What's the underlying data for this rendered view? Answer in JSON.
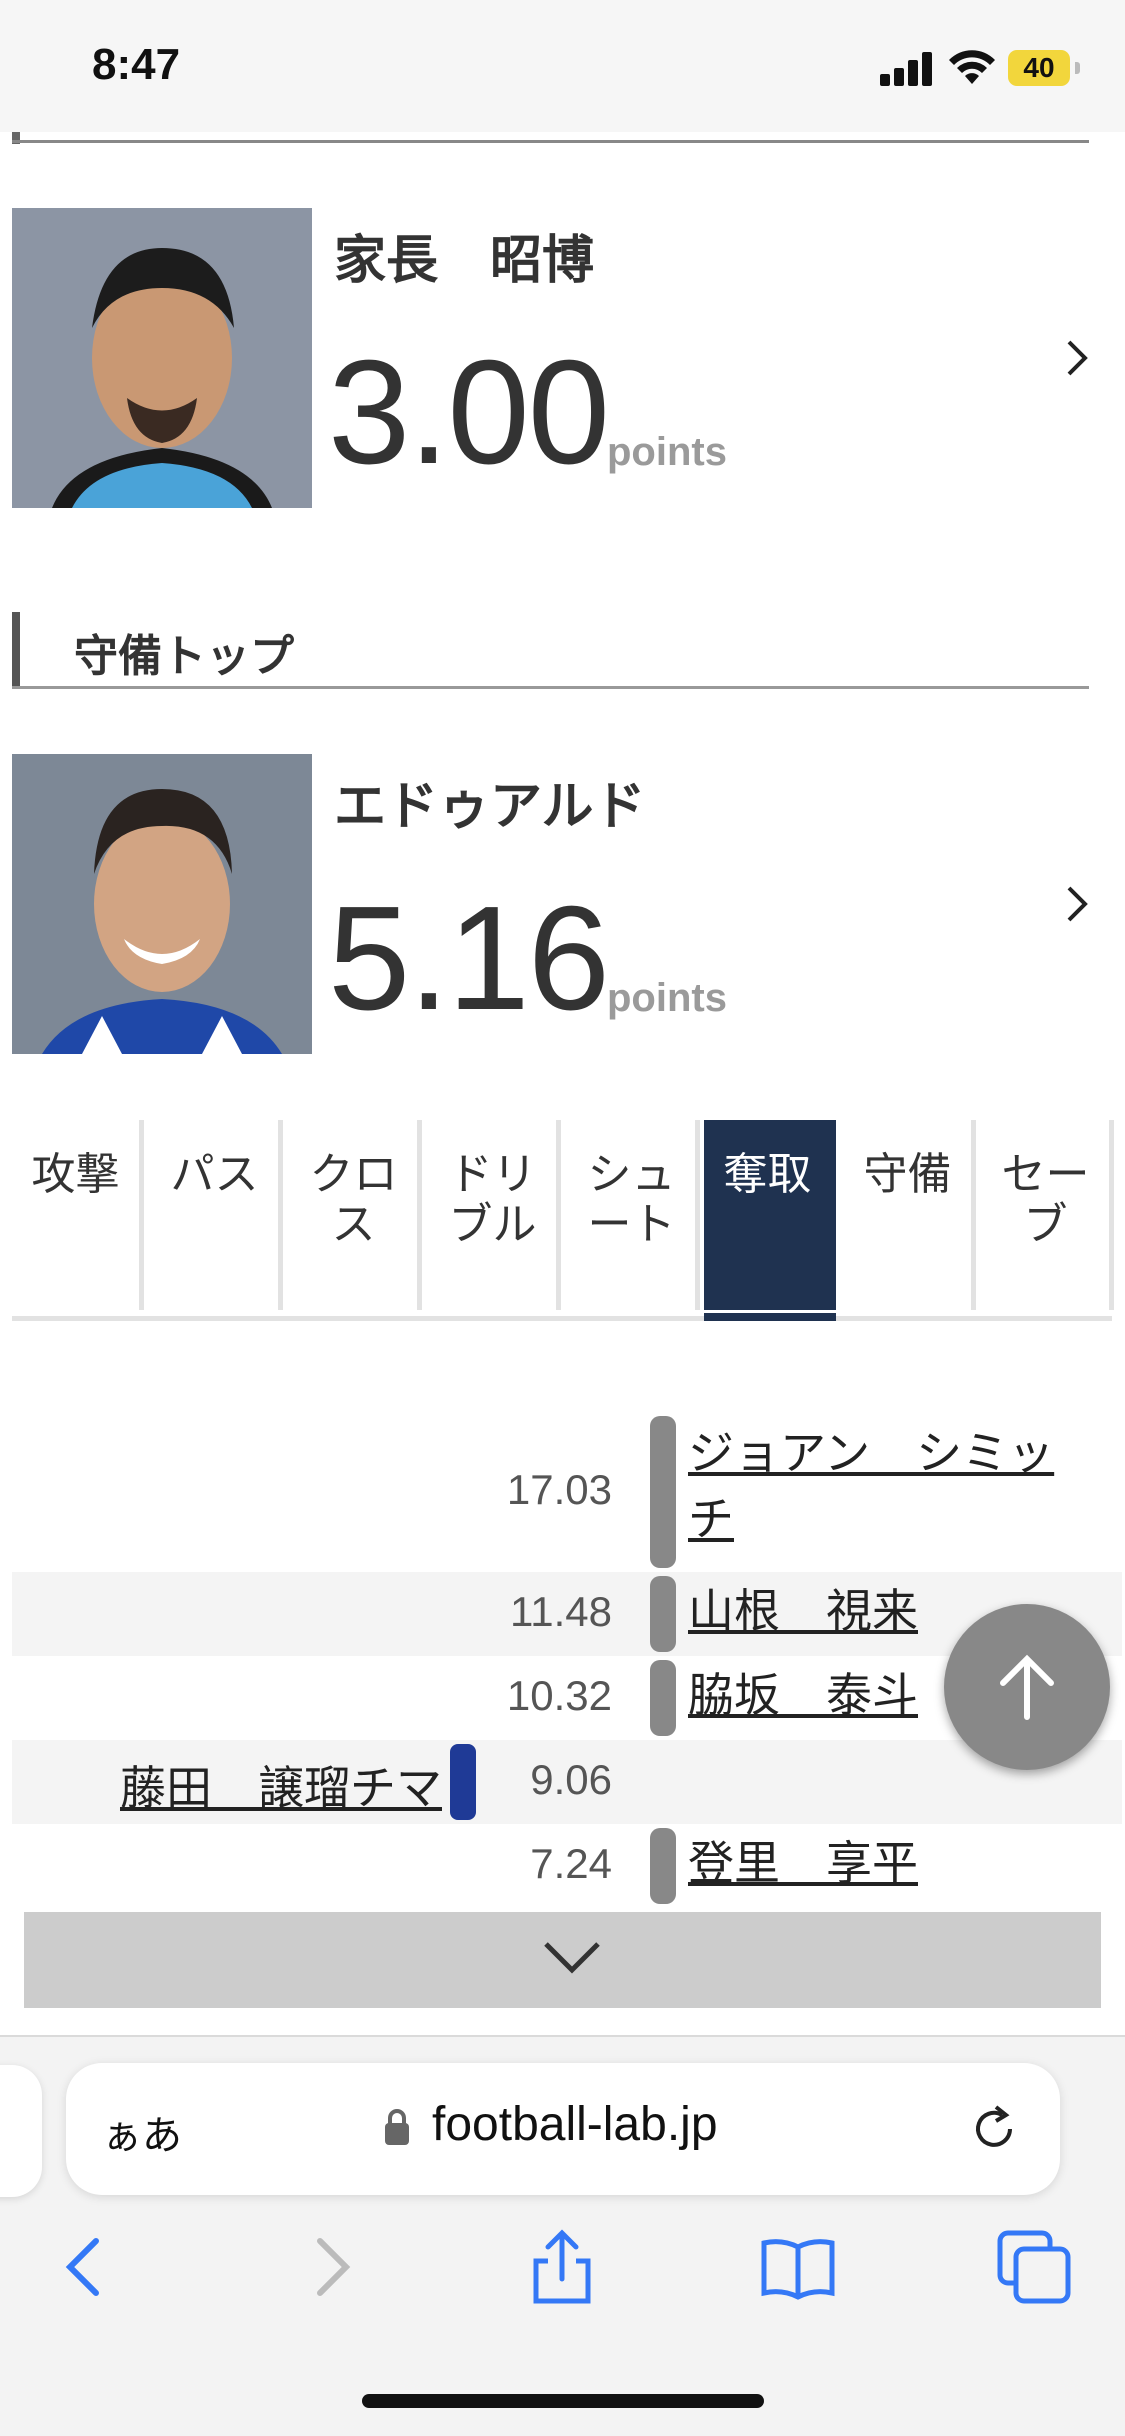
{
  "status_bar": {
    "time": "8:47",
    "battery": "40"
  },
  "players": [
    {
      "name": "家長　昭博",
      "points": "3.00",
      "points_label": "points"
    },
    {
      "name": "エドゥアルド",
      "points": "5.16",
      "points_label": "points"
    }
  ],
  "section": {
    "title": "守備トップ"
  },
  "tabs": [
    {
      "label": "攻撃",
      "active": false
    },
    {
      "label": "パス",
      "active": false
    },
    {
      "label": "クロ\nス",
      "active": false
    },
    {
      "label": "ドリ\nブル",
      "active": false
    },
    {
      "label": "シュ\nート",
      "active": false
    },
    {
      "label": "奪取",
      "active": true
    },
    {
      "label": "守備",
      "active": false
    },
    {
      "label": "セー\nブ",
      "active": false
    }
  ],
  "ranking": [
    {
      "value": "17.03",
      "name": "ジョアン　シミッ\nチ",
      "side": "right"
    },
    {
      "value": "11.48",
      "name": "山根　視来",
      "side": "right"
    },
    {
      "value": "10.32",
      "name": "脇坂　泰斗",
      "side": "right"
    },
    {
      "value": "9.06",
      "name": "藤田　譲瑠チマ",
      "side": "left"
    },
    {
      "value": "7.24",
      "name": "登里　享平",
      "side": "right"
    }
  ],
  "browser": {
    "aa_label": "ぁあ",
    "url": "football-lab.jp"
  },
  "colors": {
    "active_tab": "#1f3250",
    "home_bar": "#888888",
    "away_bar": "#1f3a96",
    "link_blue": "#3478f6"
  },
  "icons": [
    "signal-icon",
    "wifi-icon",
    "battery-icon",
    "chevron-right-icon",
    "chevron-down-icon",
    "arrow-up-icon",
    "lock-icon",
    "reload-icon",
    "back-icon",
    "forward-icon",
    "share-icon",
    "bookmarks-icon",
    "tabs-icon"
  ]
}
